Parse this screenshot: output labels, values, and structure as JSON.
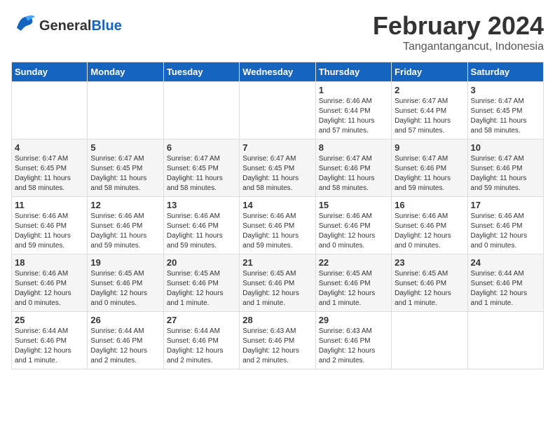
{
  "header": {
    "logo_text_general": "General",
    "logo_text_blue": "Blue",
    "title": "February 2024",
    "subtitle": "Tangantangancut, Indonesia"
  },
  "days_of_week": [
    "Sunday",
    "Monday",
    "Tuesday",
    "Wednesday",
    "Thursday",
    "Friday",
    "Saturday"
  ],
  "weeks": [
    [
      {
        "day": "",
        "info": ""
      },
      {
        "day": "",
        "info": ""
      },
      {
        "day": "",
        "info": ""
      },
      {
        "day": "",
        "info": ""
      },
      {
        "day": "1",
        "info": "Sunrise: 6:46 AM\nSunset: 6:44 PM\nDaylight: 11 hours\nand 57 minutes."
      },
      {
        "day": "2",
        "info": "Sunrise: 6:47 AM\nSunset: 6:44 PM\nDaylight: 11 hours\nand 57 minutes."
      },
      {
        "day": "3",
        "info": "Sunrise: 6:47 AM\nSunset: 6:45 PM\nDaylight: 11 hours\nand 58 minutes."
      }
    ],
    [
      {
        "day": "4",
        "info": "Sunrise: 6:47 AM\nSunset: 6:45 PM\nDaylight: 11 hours\nand 58 minutes."
      },
      {
        "day": "5",
        "info": "Sunrise: 6:47 AM\nSunset: 6:45 PM\nDaylight: 11 hours\nand 58 minutes."
      },
      {
        "day": "6",
        "info": "Sunrise: 6:47 AM\nSunset: 6:45 PM\nDaylight: 11 hours\nand 58 minutes."
      },
      {
        "day": "7",
        "info": "Sunrise: 6:47 AM\nSunset: 6:45 PM\nDaylight: 11 hours\nand 58 minutes."
      },
      {
        "day": "8",
        "info": "Sunrise: 6:47 AM\nSunset: 6:46 PM\nDaylight: 11 hours\nand 58 minutes."
      },
      {
        "day": "9",
        "info": "Sunrise: 6:47 AM\nSunset: 6:46 PM\nDaylight: 11 hours\nand 59 minutes."
      },
      {
        "day": "10",
        "info": "Sunrise: 6:47 AM\nSunset: 6:46 PM\nDaylight: 11 hours\nand 59 minutes."
      }
    ],
    [
      {
        "day": "11",
        "info": "Sunrise: 6:46 AM\nSunset: 6:46 PM\nDaylight: 11 hours\nand 59 minutes."
      },
      {
        "day": "12",
        "info": "Sunrise: 6:46 AM\nSunset: 6:46 PM\nDaylight: 11 hours\nand 59 minutes."
      },
      {
        "day": "13",
        "info": "Sunrise: 6:46 AM\nSunset: 6:46 PM\nDaylight: 11 hours\nand 59 minutes."
      },
      {
        "day": "14",
        "info": "Sunrise: 6:46 AM\nSunset: 6:46 PM\nDaylight: 11 hours\nand 59 minutes."
      },
      {
        "day": "15",
        "info": "Sunrise: 6:46 AM\nSunset: 6:46 PM\nDaylight: 12 hours\nand 0 minutes."
      },
      {
        "day": "16",
        "info": "Sunrise: 6:46 AM\nSunset: 6:46 PM\nDaylight: 12 hours\nand 0 minutes."
      },
      {
        "day": "17",
        "info": "Sunrise: 6:46 AM\nSunset: 6:46 PM\nDaylight: 12 hours\nand 0 minutes."
      }
    ],
    [
      {
        "day": "18",
        "info": "Sunrise: 6:46 AM\nSunset: 6:46 PM\nDaylight: 12 hours\nand 0 minutes."
      },
      {
        "day": "19",
        "info": "Sunrise: 6:45 AM\nSunset: 6:46 PM\nDaylight: 12 hours\nand 0 minutes."
      },
      {
        "day": "20",
        "info": "Sunrise: 6:45 AM\nSunset: 6:46 PM\nDaylight: 12 hours\nand 1 minute."
      },
      {
        "day": "21",
        "info": "Sunrise: 6:45 AM\nSunset: 6:46 PM\nDaylight: 12 hours\nand 1 minute."
      },
      {
        "day": "22",
        "info": "Sunrise: 6:45 AM\nSunset: 6:46 PM\nDaylight: 12 hours\nand 1 minute."
      },
      {
        "day": "23",
        "info": "Sunrise: 6:45 AM\nSunset: 6:46 PM\nDaylight: 12 hours\nand 1 minute."
      },
      {
        "day": "24",
        "info": "Sunrise: 6:44 AM\nSunset: 6:46 PM\nDaylight: 12 hours\nand 1 minute."
      }
    ],
    [
      {
        "day": "25",
        "info": "Sunrise: 6:44 AM\nSunset: 6:46 PM\nDaylight: 12 hours\nand 1 minute."
      },
      {
        "day": "26",
        "info": "Sunrise: 6:44 AM\nSunset: 6:46 PM\nDaylight: 12 hours\nand 2 minutes."
      },
      {
        "day": "27",
        "info": "Sunrise: 6:44 AM\nSunset: 6:46 PM\nDaylight: 12 hours\nand 2 minutes."
      },
      {
        "day": "28",
        "info": "Sunrise: 6:43 AM\nSunset: 6:46 PM\nDaylight: 12 hours\nand 2 minutes."
      },
      {
        "day": "29",
        "info": "Sunrise: 6:43 AM\nSunset: 6:46 PM\nDaylight: 12 hours\nand 2 minutes."
      },
      {
        "day": "",
        "info": ""
      },
      {
        "day": "",
        "info": ""
      }
    ]
  ]
}
